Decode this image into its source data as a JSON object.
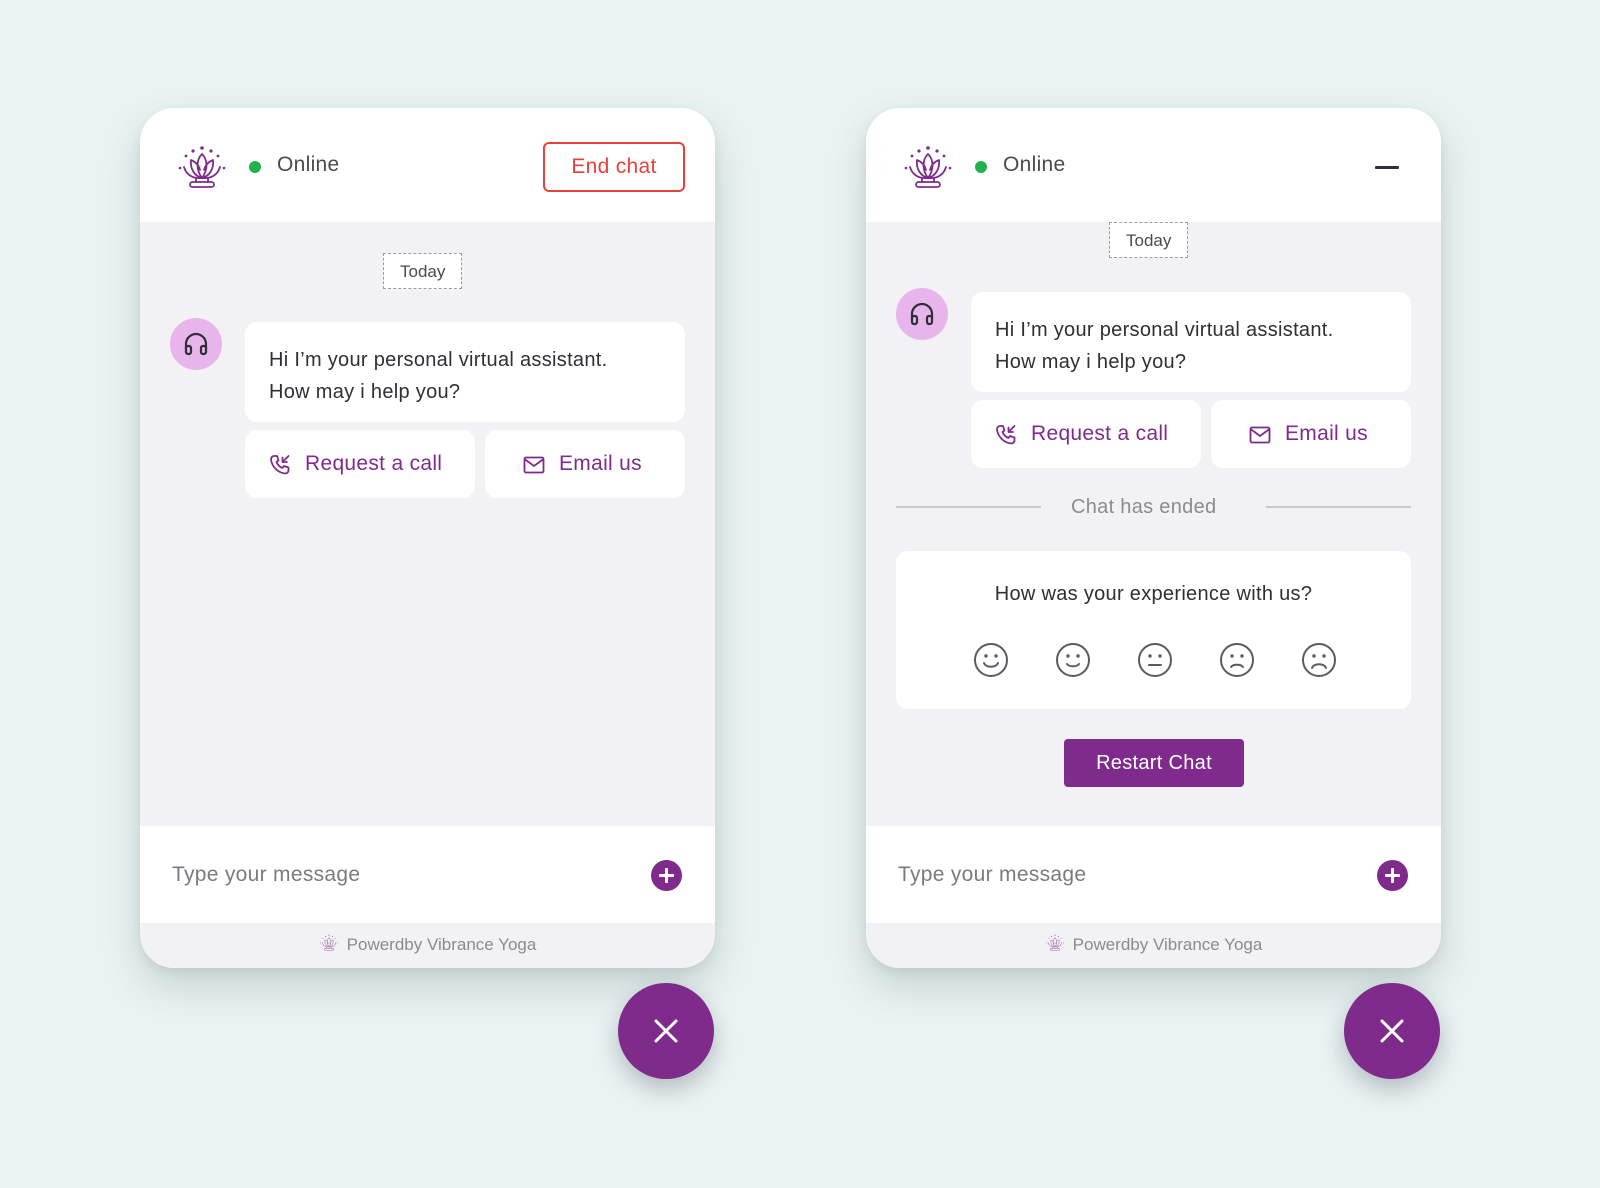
{
  "colors": {
    "page_bg": "#e9f3f2",
    "brand_purple": "#7e2b8c",
    "avatar_bg": "#e7b5ec",
    "online_green": "#22b14c",
    "end_chat_red": "#e8413c"
  },
  "widgets": [
    {
      "header": {
        "logo_icon": "lotus-logo-icon",
        "status": "Online",
        "end_chat_label": "End chat"
      },
      "date_label": "Today",
      "assistant_message": {
        "line1": "Hi I’m your personal virtual assistant.",
        "line2": "How may i help you?"
      },
      "actions": [
        {
          "label": "Request a call",
          "icon": "phone-incoming-icon"
        },
        {
          "label": "Email us",
          "icon": "mail-icon"
        }
      ],
      "composer": {
        "placeholder": "Type your message",
        "value": ""
      },
      "footer": "Powerdby Vibrance Yoga"
    },
    {
      "header": {
        "logo_icon": "lotus-logo-icon",
        "status": "Online",
        "minimize_icon": "minimize-icon"
      },
      "date_label": "Today",
      "assistant_message": {
        "line1": "Hi I’m your personal virtual assistant.",
        "line2": "How may i help you?"
      },
      "actions": [
        {
          "label": "Request a call",
          "icon": "phone-incoming-icon"
        },
        {
          "label": "Email us",
          "icon": "mail-icon"
        }
      ],
      "chat_ended_label": "Chat has ended",
      "rating": {
        "question": "How was your experience with us?",
        "faces": [
          "very-happy-face-icon",
          "happy-face-icon",
          "neutral-face-icon",
          "unhappy-face-icon",
          "very-unhappy-face-icon"
        ]
      },
      "restart_label": "Restart Chat",
      "composer": {
        "placeholder": "Type your message",
        "value": ""
      },
      "footer": "Powerdby Vibrance Yoga"
    }
  ]
}
